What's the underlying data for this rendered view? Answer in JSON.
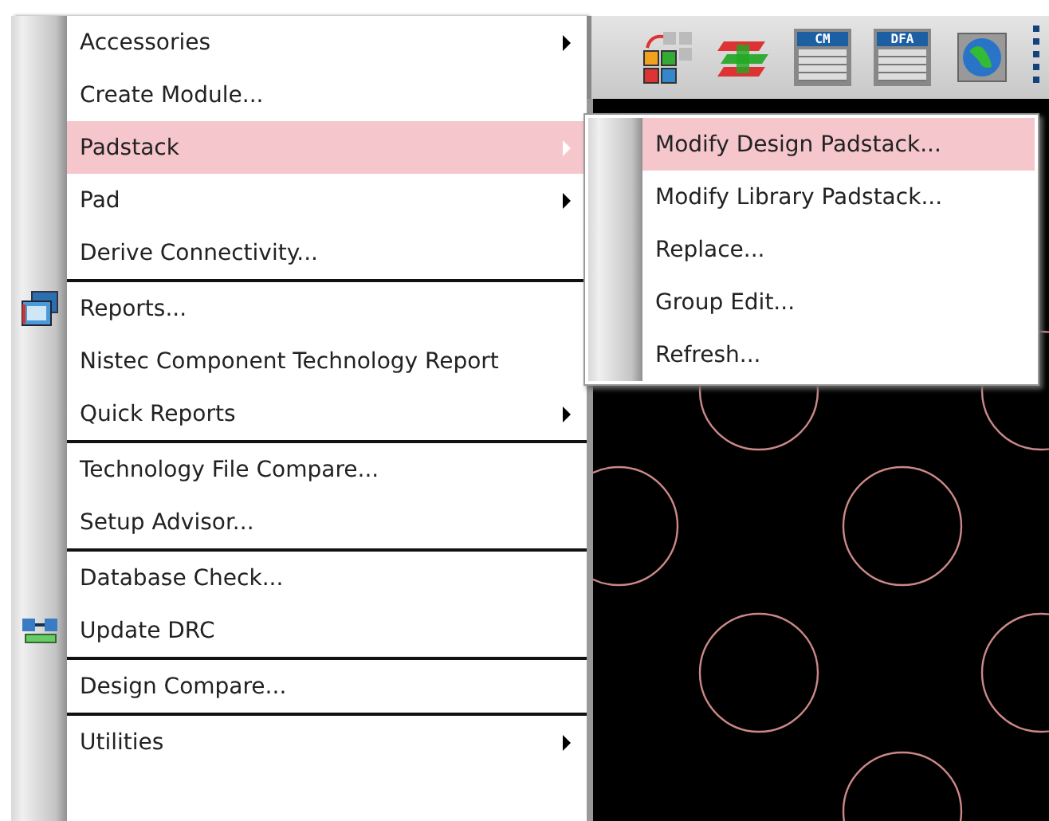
{
  "menu": {
    "items": [
      {
        "kind": "item",
        "label": "Accessories",
        "submenu": true,
        "selected": false
      },
      {
        "kind": "item",
        "label": "Create Module...",
        "submenu": false,
        "selected": false
      },
      {
        "kind": "item",
        "label": "Padstack",
        "submenu": true,
        "selected": true
      },
      {
        "kind": "item",
        "label": "Pad",
        "submenu": true,
        "selected": false
      },
      {
        "kind": "item",
        "label": "Derive Connectivity...",
        "submenu": false,
        "selected": false
      },
      {
        "kind": "separator"
      },
      {
        "kind": "icon_item",
        "label": "Reports...",
        "submenu": false,
        "selected": false
      },
      {
        "kind": "item",
        "label": "Nistec Component Technology Report",
        "submenu": false,
        "selected": false
      },
      {
        "kind": "item",
        "label": "Quick Reports",
        "submenu": true,
        "selected": false
      },
      {
        "kind": "separator"
      },
      {
        "kind": "item",
        "label": "Technology File Compare...",
        "submenu": false,
        "selected": false
      },
      {
        "kind": "item",
        "label": "Setup Advisor...",
        "submenu": false,
        "selected": false
      },
      {
        "kind": "separator"
      },
      {
        "kind": "item",
        "label": "Database Check...",
        "submenu": false,
        "selected": false
      },
      {
        "kind": "icon_item",
        "label": "Update DRC",
        "submenu": false,
        "selected": false
      },
      {
        "kind": "separator"
      },
      {
        "kind": "item",
        "label": "Design Compare...",
        "submenu": false,
        "selected": false
      },
      {
        "kind": "separator"
      },
      {
        "kind": "item",
        "label": "Utilities",
        "submenu": true,
        "selected": false
      }
    ]
  },
  "submenu": {
    "items": [
      {
        "label": "Modify Design Padstack...",
        "selected": true
      },
      {
        "label": "Modify Library Padstack...",
        "selected": false
      },
      {
        "label": "Replace...",
        "selected": false
      },
      {
        "label": "Group Edit...",
        "selected": false
      },
      {
        "label": "Refresh...",
        "selected": false
      }
    ]
  },
  "toolbar": {
    "buttons": [
      {
        "kind": "grid"
      },
      {
        "kind": "layers"
      },
      {
        "kind": "table",
        "caption": "CM"
      },
      {
        "kind": "table",
        "caption": "DFA"
      },
      {
        "kind": "globe"
      }
    ]
  }
}
